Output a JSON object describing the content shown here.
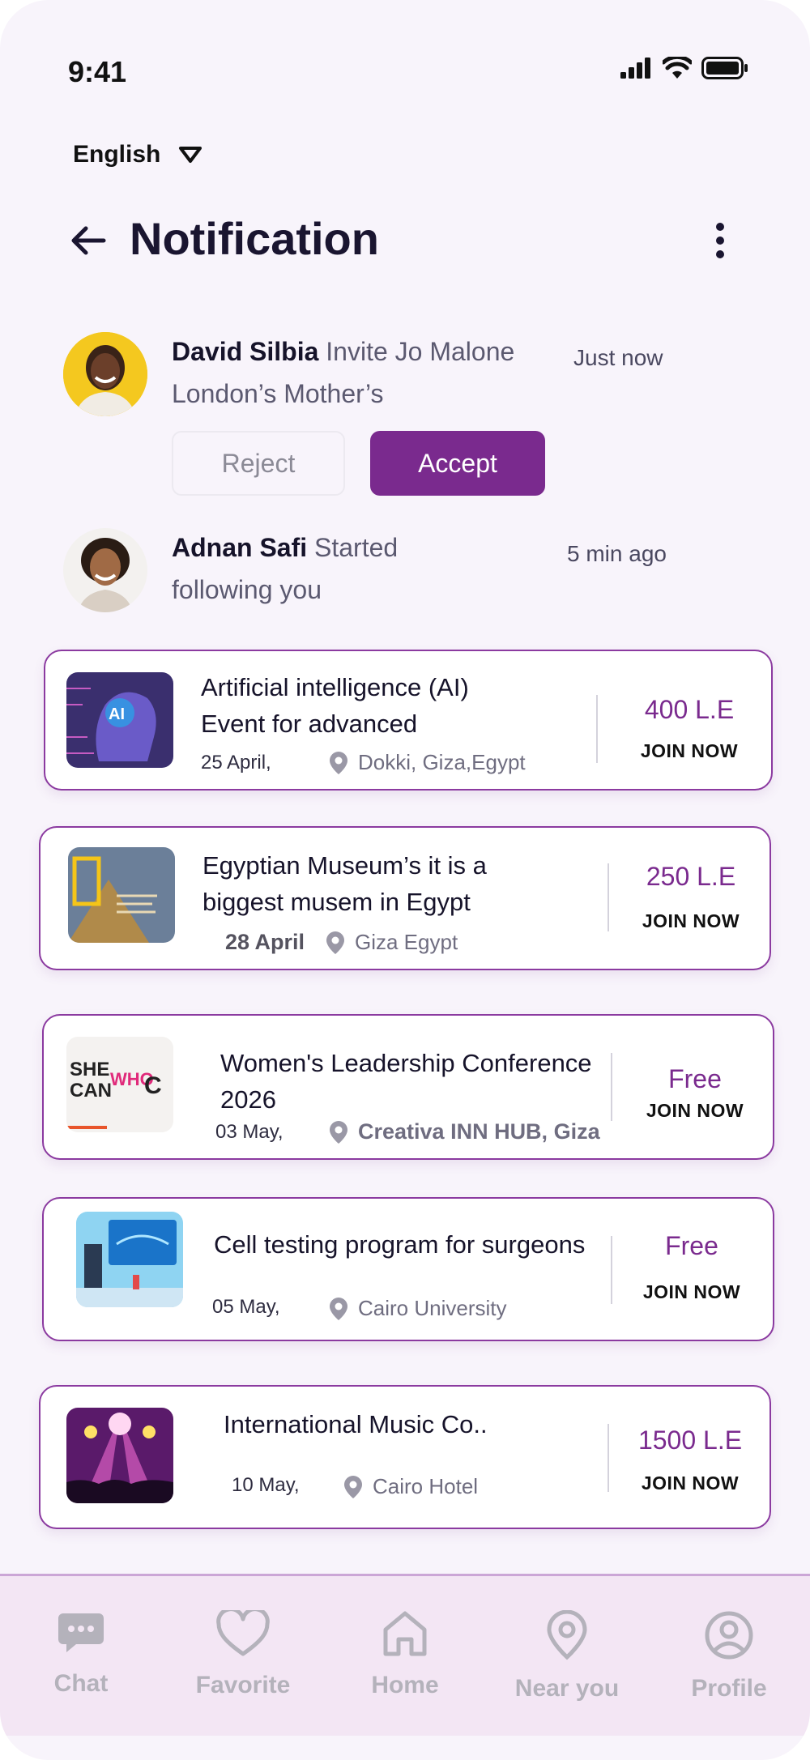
{
  "status_bar": {
    "time": "9:41"
  },
  "language": {
    "label": "English"
  },
  "header": {
    "title": "Notification"
  },
  "notifications": [
    {
      "name": "David Silbia",
      "text_line1": "Invite Jo Malone",
      "text_line2": "London’s Mother’s",
      "time": "Just now",
      "reject_label": "Reject",
      "accept_label": "Accept"
    },
    {
      "name": "Adnan Safi",
      "text_line1": "Started",
      "text_line2": "following you",
      "time": "5 min ago"
    }
  ],
  "events": [
    {
      "title_line1": "Artificial intelligence (AI)",
      "title_line2": "Event for advanced",
      "date": "25 April,",
      "location": "Dokki, Giza,Egypt",
      "price": "400 L.E",
      "join": "JOIN NOW"
    },
    {
      "title_line1": "Egyptian Museum’s it is a",
      "title_line2": "biggest musem in Egypt",
      "date": "28 April",
      "location": "Giza Egypt",
      "price": "250 L.E",
      "join": "JOIN NOW"
    },
    {
      "title_line1": "Women's Leadership Conference",
      "title_line2": "2026",
      "date": "03 May,",
      "location": "Creativa INN HUB, Giza",
      "price": "Free",
      "join": "JOIN NOW"
    },
    {
      "title_line1": "Cell testing program for surgeons",
      "title_line2": "",
      "date": "05 May,",
      "location": "Cairo University",
      "price": "Free",
      "join": "JOIN NOW"
    },
    {
      "title_line1": "International Music Co..",
      "title_line2": "",
      "date": "10 May,",
      "location": "Cairo Hotel",
      "price": "1500 L.E",
      "join": "JOIN NOW"
    }
  ],
  "nav": [
    {
      "label": "Chat",
      "icon": "chat-icon"
    },
    {
      "label": "Favorite",
      "icon": "heart-icon"
    },
    {
      "label": "Home",
      "icon": "home-icon"
    },
    {
      "label": "Near you",
      "icon": "location-icon"
    },
    {
      "label": "Profile",
      "icon": "profile-icon"
    }
  ],
  "colors": {
    "accent": "#7a2a8e",
    "card_border": "#8b3aa0",
    "background": "#f8f4fb",
    "nav_bg": "#f3e6f4",
    "nav_icon": "#b4b2bb"
  }
}
